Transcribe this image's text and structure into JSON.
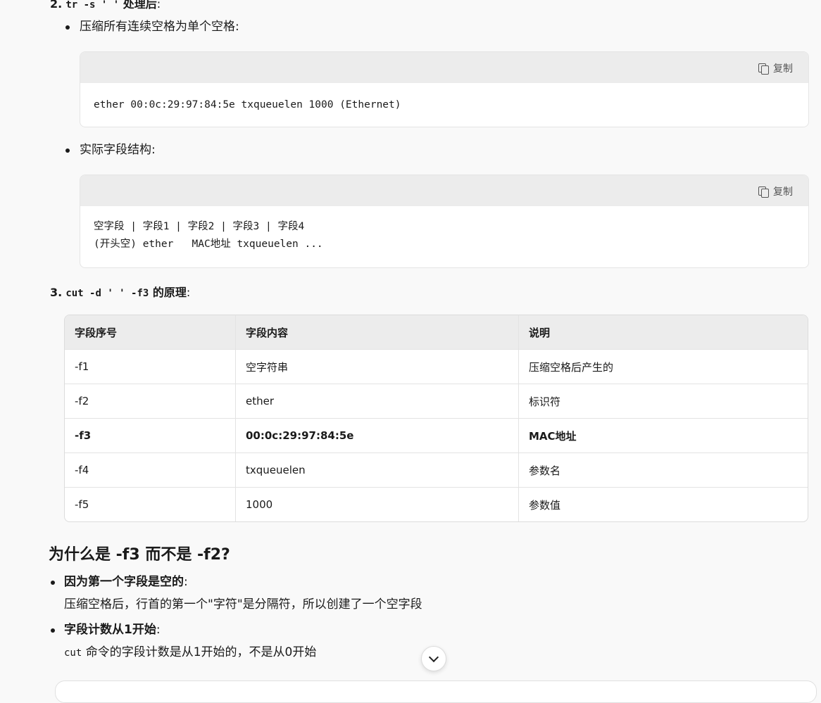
{
  "item2": {
    "number": "2.",
    "code": "tr -s ' '",
    "heading": " 处理后",
    "colon": ":",
    "bullet1": "压缩所有连续空格为单个空格:",
    "code1": "ether 00:0c:29:97:84:5e txqueuelen 1000 (Ethernet)",
    "bullet2": "实际字段结构:",
    "code2_line1": "空字段 | 字段1 | 字段2 | 字段3 | 字段4",
    "code2_line2": "(开头空) ether   MAC地址 txqueuelen ..."
  },
  "copy_label": "复制",
  "item3": {
    "number": "3.",
    "code": "cut -d ' ' -f3",
    "heading": " 的原理",
    "colon": ":"
  },
  "table": {
    "headers": [
      "字段序号",
      "字段内容",
      "说明"
    ],
    "rows": [
      [
        "-f1",
        "空字符串",
        "压缩空格后产生的"
      ],
      [
        "-f2",
        "ether",
        "标识符"
      ],
      [
        "-f3",
        "00:0c:29:97:84:5e",
        "MAC地址"
      ],
      [
        "-f4",
        "txqueuelen",
        "参数名"
      ],
      [
        "-f5",
        "1000",
        "参数值"
      ]
    ]
  },
  "section": {
    "title": "为什么是 -f3 而不是 -f2?",
    "b1_bold": "因为第一个字段是空的",
    "b1_colon": ":",
    "b1_text": "压缩空格后，行首的第一个\"字符\"是分隔符，所以创建了一个空字段",
    "b2_bold": "字段计数从1开始",
    "b2_colon": ":",
    "b2_code": "cut",
    "b2_text": " 命令的字段计数是从1开始的，不是从0开始"
  }
}
